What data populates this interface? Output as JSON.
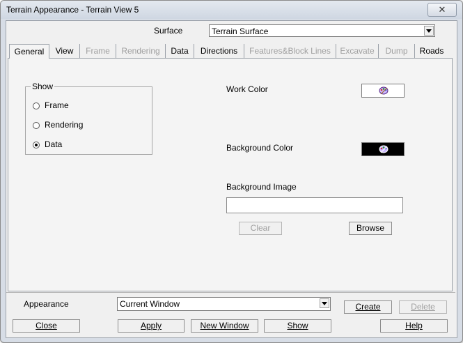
{
  "window": {
    "title": "Terrain Appearance - Terrain View 5",
    "close_glyph": "✕"
  },
  "surface": {
    "label": "Surface",
    "value": "Terrain Surface"
  },
  "tabs": [
    {
      "label": "General",
      "state": "active"
    },
    {
      "label": "View",
      "state": "enabled"
    },
    {
      "label": "Frame",
      "state": "disabled"
    },
    {
      "label": "Rendering",
      "state": "disabled"
    },
    {
      "label": "Data",
      "state": "enabled"
    },
    {
      "label": "Directions",
      "state": "enabled"
    },
    {
      "label": "Features&Block Lines",
      "state": "disabled"
    },
    {
      "label": "Excavate",
      "state": "disabled"
    },
    {
      "label": "Dump",
      "state": "disabled"
    },
    {
      "label": "Roads",
      "state": "enabled"
    }
  ],
  "show_group": {
    "legend": "Show",
    "options": [
      {
        "label": "Frame",
        "selected": false
      },
      {
        "label": "Rendering",
        "selected": false
      },
      {
        "label": "Data",
        "selected": true
      }
    ]
  },
  "work_color": {
    "label": "Work Color",
    "color": "#ffffff",
    "icon": "palette-icon"
  },
  "background_color": {
    "label": "Background Color",
    "color": "#000000",
    "icon": "palette-icon"
  },
  "background_image": {
    "label": "Background Image",
    "value": "",
    "clear_label": "Clear",
    "browse_label": "Browse"
  },
  "appearance": {
    "label": "Appearance",
    "value": "Current Window",
    "create_label": "Create",
    "delete_label": "Delete"
  },
  "footer": {
    "close_label": "Close",
    "apply_label": "Apply",
    "new_window_label": "New Window",
    "show_label": "Show",
    "help_label": "Help"
  }
}
